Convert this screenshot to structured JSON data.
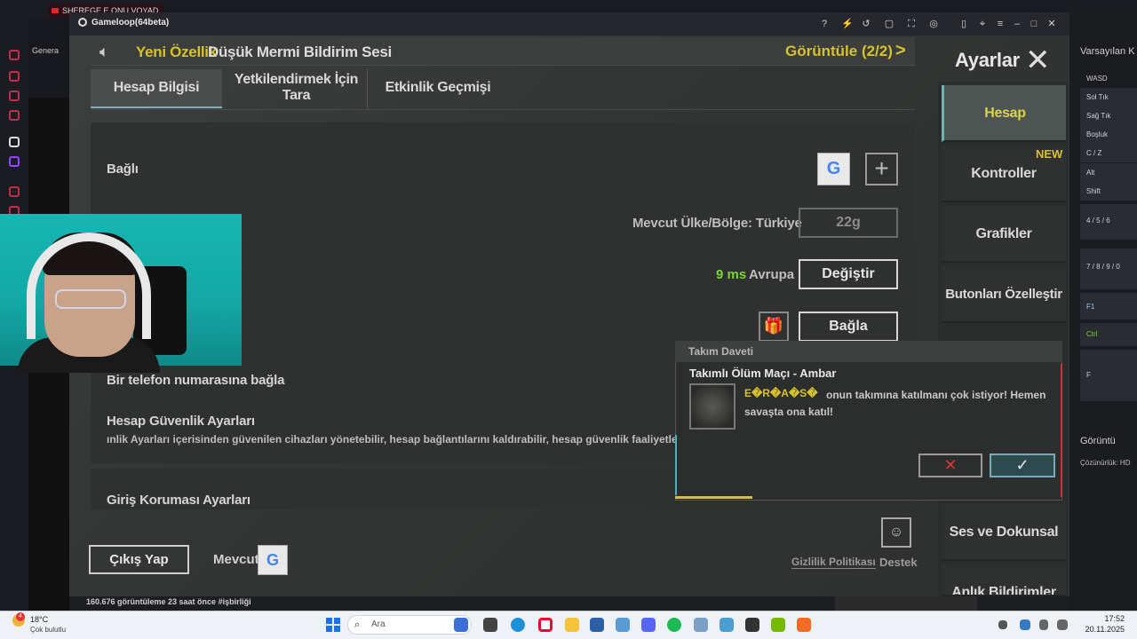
{
  "browser": {
    "tab_title": "SHEREGE E ONU VOYAD",
    "sidebar_label": "Genera"
  },
  "gameloop": {
    "title": "Gameloop(64beta)"
  },
  "banner": {
    "new_label": "Yeni Özellik",
    "text": "Düşük Mermi Bildirim Sesi",
    "view": "Görüntüle (2/2)",
    "arrow": ">"
  },
  "tabs": {
    "account_info": "Hesap Bilgisi",
    "authorize_line1": "Yetkilendirmek İçin",
    "authorize_line2": "Tara",
    "event_history": "Etkinlik Geçmişi"
  },
  "account": {
    "linked_label": "Bağlı",
    "google_glyph": "G",
    "plus_glyph": "+",
    "region_label": "Mevcut Ülke/Bölge: Türkiye",
    "region_value": "22g",
    "ping_value": "9 ms",
    "ping_region": "Avrupa",
    "change_button": "Değiştir",
    "gift_glyph": "🎁",
    "link_button": "Bağla",
    "phone_label": "Bir telefon numarasına bağla",
    "security_label": "Hesap Güvenlik Ayarları",
    "security_desc": "ınlik Ayarları içerisinden güvenilen cihazları yönetebilir, hesap bağlantılarını kaldırabilir, hesap güvenlik faaliyetleri",
    "login_protection_label": "Giriş Koruması Ayarları"
  },
  "footer": {
    "logout_button": "Çıkış Yap",
    "current_label": "Mevcut",
    "current_glyph": "G",
    "privacy_link": "Gizlilik Politikası",
    "support_label": "Destek",
    "support_glyph": "☺"
  },
  "settings": {
    "title": "Ayarlar",
    "close_glyph": "✕",
    "menu": [
      "Hesap",
      "Kontroller",
      "Grafikler",
      "Butonları Özelleştir",
      "Ses ve Dokunsal",
      "Anlık Bildirimler"
    ],
    "new_badge": "NEW"
  },
  "invite": {
    "header": "Takım Daveti",
    "title": "Takımlı Ölüm Maçı - Ambar",
    "sender": "E�R�A�S�",
    "message": "onun takımına katılmanı çok istiyor! Hemen savaşta ona katıl!",
    "reject_glyph": "✕",
    "accept_glyph": "✓",
    "progress": 0.2
  },
  "host_panel": {
    "title": "Varsayılan K",
    "keys": [
      "WASD",
      "Sol Tık",
      "Sağ Tık",
      "Boşluk",
      "C / Z",
      "Alt",
      "Shift",
      "4 / 5 / 6",
      "7 / 8 / 9 / 0",
      "F1",
      "Ctrl",
      "F"
    ],
    "display_label": "Görüntü",
    "resolution": "Çözünürlük: HD"
  },
  "stream": {
    "views": "160.676 görüntüleme  23 saat önce  #işbirliği"
  },
  "taskbar": {
    "weather_temp": "18°C",
    "weather_desc": "Çok bulutlu",
    "weather_badge": "4",
    "search_placeholder": "Ara",
    "time": "17:52",
    "date": "20.11.2025"
  },
  "colors": {
    "accent_yellow": "#d6c22c",
    "ping_green": "#7cd33a",
    "reject_red": "#dd3333"
  }
}
